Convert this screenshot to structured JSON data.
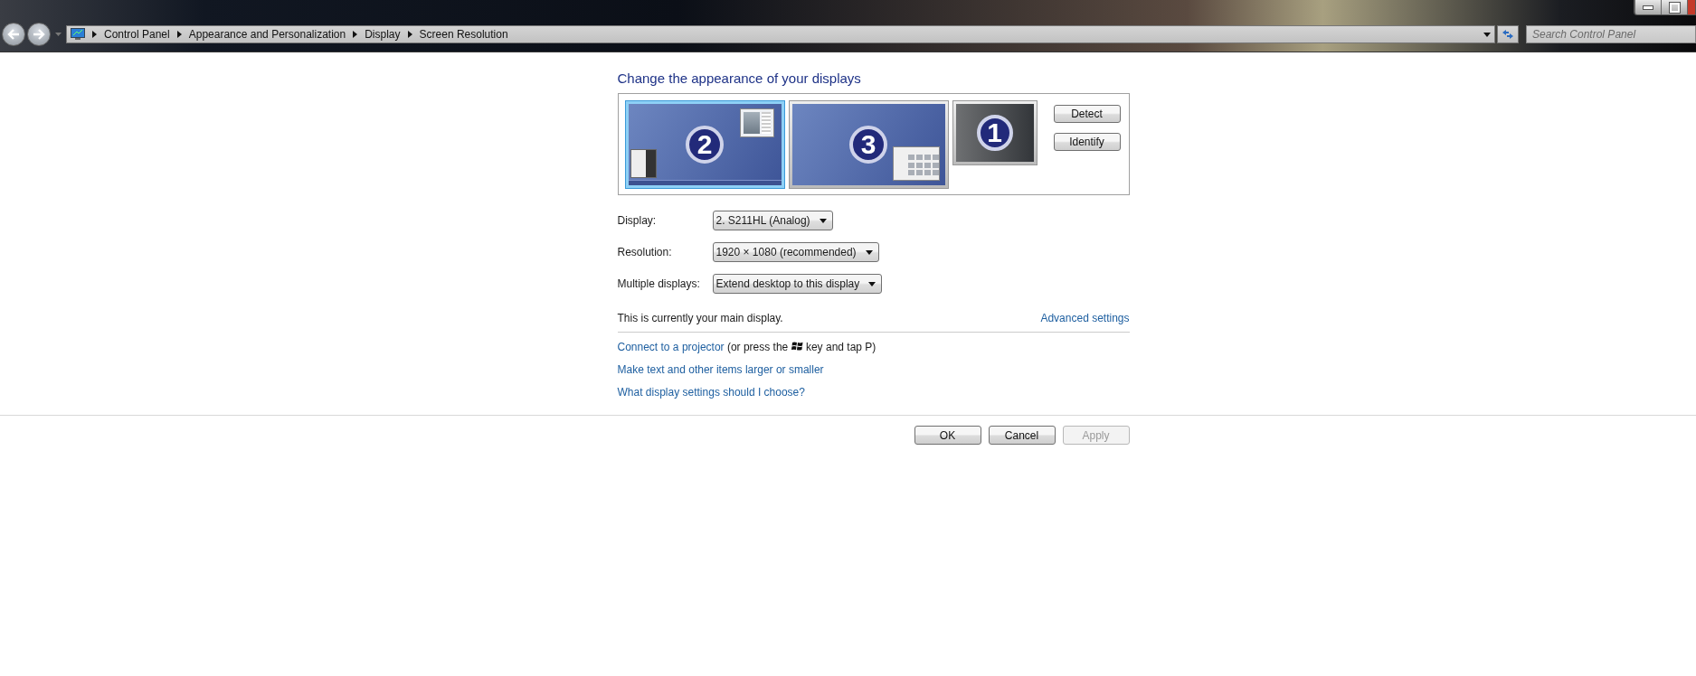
{
  "address_bar": {
    "breadcrumbs": [
      "Control Panel",
      "Appearance and Personalization",
      "Display",
      "Screen Resolution"
    ]
  },
  "search": {
    "placeholder": "Search Control Panel"
  },
  "title": "Change the appearance of your displays",
  "monitors": [
    {
      "number": "2",
      "kind": "primary",
      "selected": true
    },
    {
      "number": "3",
      "kind": "extended",
      "selected": false
    },
    {
      "number": "1",
      "kind": "inactive",
      "selected": false
    }
  ],
  "arrangement_buttons": [
    "Detect",
    "Identify"
  ],
  "settings": [
    {
      "label": "Display:",
      "value": "2. S211HL (Analog)"
    },
    {
      "label": "Resolution:",
      "value": "1920 × 1080 (recommended)"
    },
    {
      "label": "Multiple displays:",
      "value": "Extend desktop to this display"
    }
  ],
  "status_text": "This is currently your main display.",
  "advanced_link": "Advanced settings",
  "projector_hint": {
    "link": "Connect to a projector",
    "before_icon": "(or press the",
    "after_icon": "key and tap P)"
  },
  "links": [
    "Make text and other items larger or smaller",
    "What display settings should I choose?"
  ],
  "buttons": [
    {
      "label": "OK",
      "disabled": false
    },
    {
      "label": "Cancel",
      "disabled": false
    },
    {
      "label": "Apply",
      "disabled": true
    }
  ]
}
